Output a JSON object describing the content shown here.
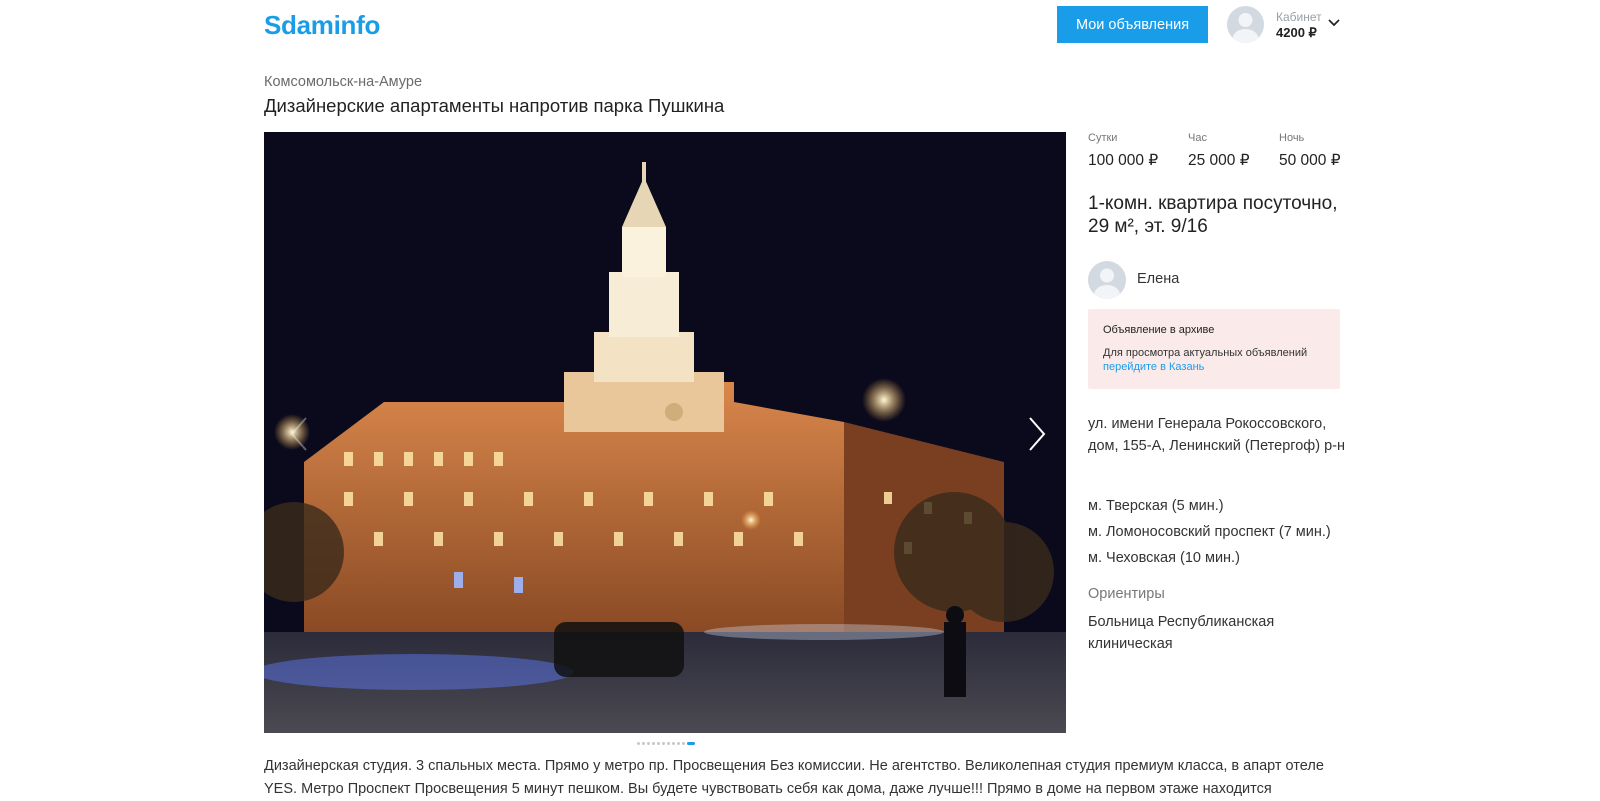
{
  "header": {
    "logo": "Sdaminfo",
    "my_ads_button": "Мои объявления",
    "cabinet_label": "Кабинет",
    "balance": "4200 ₽"
  },
  "listing": {
    "city": "Комсомольск-на-Амуре",
    "title": "Дизайнерские апартаменты напротив парка Пушкина",
    "prices": [
      {
        "label": "Сутки",
        "value": "100 000 ₽"
      },
      {
        "label": "Час",
        "value": "25 000 ₽"
      },
      {
        "label": "Ночь",
        "value": "50 000 ₽"
      }
    ],
    "flat_title_line1": "1-комн. квартира посуточно,",
    "flat_title_line2": "29 м², эт. 9/16",
    "owner_name": "Елена",
    "archive": {
      "title": "Объявление в архиве",
      "text": "Для просмотра актуальных объявлений",
      "link": "перейдите в Казань"
    },
    "address": "ул. имени Генерала Рокоссовского, дом, 155-А, Ленинский (Петергоф) р-н",
    "metro": [
      "м. Тверская (5 мин.)",
      "м. Ломоносовский проспект (7 мин.)",
      "м. Чеховская (10 мин.)"
    ],
    "landmarks_label": "Ориентиры",
    "landmarks": "Больница Республиканская клиническая",
    "description": "Дизайнерская студия. 3 спальных места. Прямо у метро пр. Просвещения Без комиссии. Не агентство. Великолепная студия премиум класса, в апарт отеле YES. Метро Проспект Просвещения 5 минут пешком. Вы будете чувствовать себя как дома, даже лучше!!! Прямо в доме на первом этаже находится"
  },
  "gallery": {
    "total_slides": 11,
    "active_slide": 10
  },
  "colors": {
    "accent": "#1a9de9",
    "archive_bg": "#fbeaea",
    "photo_night": "#0a0a1c"
  }
}
